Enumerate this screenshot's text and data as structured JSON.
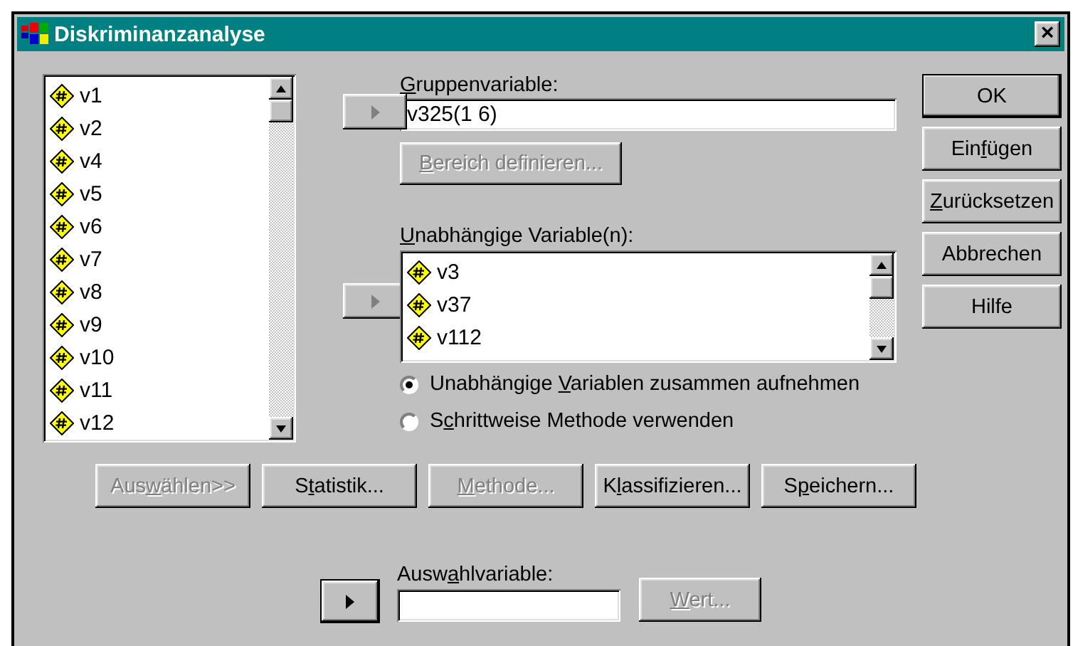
{
  "window": {
    "title": "Diskriminanzanalyse",
    "close": "×"
  },
  "source_list": {
    "items": [
      {
        "name": "v1"
      },
      {
        "name": "v2"
      },
      {
        "name": "v4"
      },
      {
        "name": "v5"
      },
      {
        "name": "v6"
      },
      {
        "name": "v7"
      },
      {
        "name": "v8"
      },
      {
        "name": "v9"
      },
      {
        "name": "v10"
      },
      {
        "name": "v11"
      },
      {
        "name": "v12"
      }
    ]
  },
  "group_variable": {
    "label": {
      "key": "G",
      "after": "ruppenvariable:"
    },
    "value": "v325(1 6)",
    "transfer": {
      "disabled": true
    }
  },
  "define_range_button": {
    "label": {
      "key": "B",
      "after": "ereich definieren..."
    },
    "disabled": true
  },
  "independent": {
    "label": {
      "key": "U",
      "after": "nabhängige Variable(n):"
    },
    "transfer": {
      "disabled": true
    },
    "items": [
      {
        "name": "v3"
      },
      {
        "name": "v37"
      },
      {
        "name": "v112"
      }
    ]
  },
  "method_options": [
    {
      "label": {
        "before": "Unabhängige ",
        "key": "V",
        "after": "ariablen zusammen aufnehmen"
      },
      "selected": true
    },
    {
      "label": {
        "before": "S",
        "key": "c",
        "after": "hrittweise Methode verwenden"
      },
      "selected": false
    }
  ],
  "dialog_buttons": [
    {
      "label": {
        "before": "OK"
      },
      "default": true,
      "disabled": false
    },
    {
      "label": {
        "before": "Ein",
        "key": "f",
        "after": "ügen"
      },
      "default": false,
      "disabled": false
    },
    {
      "label": {
        "key": "Z",
        "after": "urücksetzen"
      },
      "default": false,
      "disabled": false
    },
    {
      "label": {
        "before": "Abbrechen"
      },
      "default": false,
      "disabled": false
    },
    {
      "label": {
        "before": "Hilfe"
      },
      "default": false,
      "disabled": false
    }
  ],
  "bottom_buttons": [
    {
      "label": {
        "before": "Aus",
        "key": "w",
        "after": "ählen>>"
      },
      "disabled": true
    },
    {
      "label": {
        "before": "S",
        "key": "t",
        "after": "atistik..."
      },
      "disabled": false
    },
    {
      "label": {
        "key": "M",
        "after": "ethode..."
      },
      "disabled": true
    },
    {
      "label": {
        "before": "K",
        "key": "l",
        "after": "assifizieren..."
      },
      "disabled": false
    },
    {
      "label": {
        "before": "S",
        "key": "p",
        "after": "eichern..."
      },
      "disabled": false
    }
  ],
  "selection_variable": {
    "label": {
      "before": "Ausw",
      "key": "a",
      "after": "hlvariable:"
    },
    "transfer": {
      "disabled": false
    },
    "value_button": {
      "label": {
        "key": "W",
        "after": "ert..."
      },
      "disabled": true
    }
  }
}
